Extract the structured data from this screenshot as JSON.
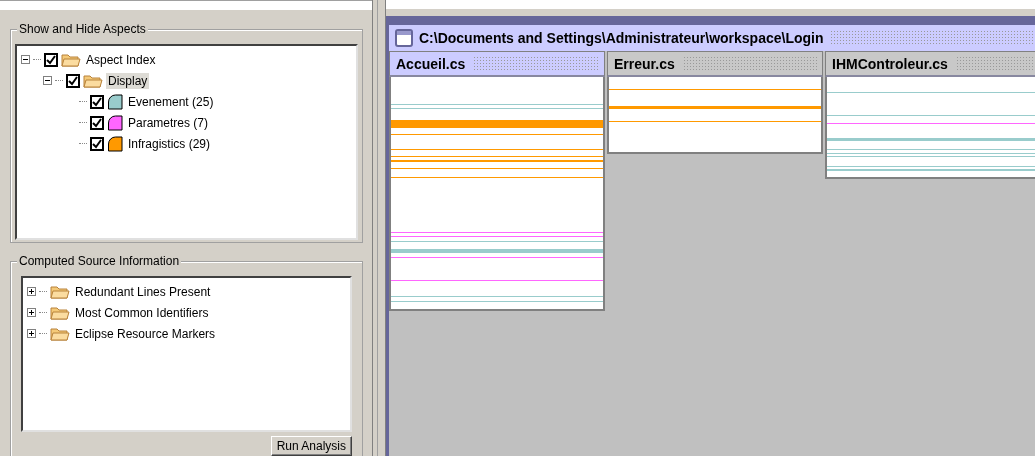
{
  "aspects_panel": {
    "title": "Show and Hide Aspects",
    "tree": [
      {
        "kind": "folder",
        "label": "Aspect Index",
        "checked": true,
        "expanded": true,
        "selected": false,
        "children": [
          {
            "kind": "folder",
            "label": "Display",
            "checked": true,
            "expanded": true,
            "selected": true,
            "children": [
              {
                "kind": "aspect",
                "label": "Evenement (25)",
                "checked": true,
                "selected": false,
                "color": "#99cccc"
              },
              {
                "kind": "aspect",
                "label": "Parametres (7)",
                "checked": true,
                "selected": false,
                "color": "#ff66ff"
              },
              {
                "kind": "aspect",
                "label": "Infragistics (29)",
                "checked": true,
                "selected": false,
                "color": "#ff9900"
              }
            ]
          }
        ]
      }
    ]
  },
  "source_panel": {
    "title": "Computed Source Information",
    "tree": [
      {
        "kind": "folder",
        "label": "Redundant Lines Present",
        "expanded": false,
        "selected": false
      },
      {
        "kind": "folder",
        "label": "Most Common Identifiers",
        "expanded": false,
        "selected": false
      },
      {
        "kind": "folder",
        "label": "Eclipse Resource Markers",
        "expanded": false,
        "selected": false
      }
    ]
  },
  "run_button": "Run Analysis",
  "workspace": {
    "title": "C:\\Documents and Settings\\Administrateur\\workspace\\Login",
    "files": [
      {
        "name": "Accueil.cs",
        "selected": true
      },
      {
        "name": "Erreur.cs",
        "selected": false
      },
      {
        "name": "IHMControleur.cs",
        "selected": false
      }
    ]
  }
}
